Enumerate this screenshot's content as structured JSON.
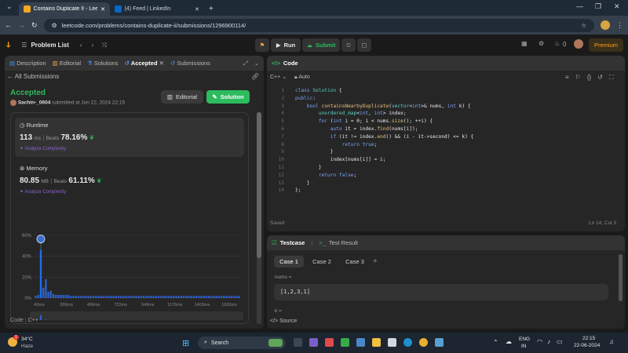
{
  "browser": {
    "tabs": [
      {
        "title": "Contains Duplicate II - LeetCode",
        "active": true
      },
      {
        "title": "(4) Feed | LinkedIn",
        "active": false
      }
    ],
    "url": "leetcode.com/problems/contains-duplicate-ii/submissions/1296900114/"
  },
  "nav": {
    "problem_list": "Problem List",
    "run": "Run",
    "submit": "Submit",
    "streak": "0",
    "premium": "Premium"
  },
  "left": {
    "tabs": [
      "Description",
      "Editorial",
      "Solutions",
      "Accepted",
      "Submissions"
    ],
    "all_submissions": "All Submissions",
    "status": "Accepted",
    "user": "Sachin-_0604",
    "submitted": "submitted at Jun 22, 2024 22:15",
    "editorial_btn": "Editorial",
    "solution_btn": "Solution",
    "runtime": {
      "label": "Runtime",
      "value": "113",
      "unit": "ms",
      "beats_label": "Beats",
      "beats": "78.16%",
      "analyze": "Analyze Complexity"
    },
    "memory": {
      "label": "Memory",
      "value": "80.85",
      "unit": "MB",
      "beats_label": "Beats",
      "beats": "61.11%",
      "analyze": "Analyze Complexity"
    },
    "footer": {
      "code": "Code",
      "lang": "C++"
    }
  },
  "chart_data": {
    "type": "bar",
    "y_ticks": [
      "60%",
      "40%",
      "20%",
      "0%"
    ],
    "ylim": [
      0,
      60
    ],
    "x_ticks": [
      "42ms",
      "269ms",
      "496ms",
      "722ms",
      "949ms",
      "1176ms",
      "1403ms",
      "1630ms"
    ],
    "values": [
      2,
      3,
      46,
      10,
      18,
      6,
      7,
      4,
      3,
      3,
      3,
      3,
      3,
      3,
      2,
      2,
      2,
      2,
      2,
      2,
      2,
      2,
      2,
      2,
      2,
      2,
      2,
      2,
      2,
      2,
      2,
      2,
      2,
      2,
      2,
      2,
      2,
      2,
      2,
      2,
      2,
      2,
      2,
      2,
      2,
      2,
      2,
      2,
      2,
      2,
      2,
      2,
      2,
      2,
      2,
      2,
      2,
      2,
      2,
      2,
      2,
      2,
      2,
      2,
      2,
      2,
      2,
      2,
      2,
      2,
      2,
      2,
      2,
      2,
      2,
      2,
      2,
      2,
      2,
      2,
      2,
      2
    ],
    "highlight_index": 2,
    "range_ticks": [
      "42ms",
      "496ms",
      "949ms",
      "1403ms"
    ]
  },
  "editor": {
    "title": "Code",
    "lang": "C++",
    "mode": "Auto",
    "saved": "Saved",
    "cursor": "Ln 14, Col 3",
    "lines": [
      "class Solution {",
      "public:",
      "    bool containsNearbyDuplicate(vector<int>& nums, int k) {",
      "        unordered_map<int, int> index;",
      "        for (int i = 0; i < nums.size(); ++i) {",
      "            auto it = index.find(nums[i]);",
      "            if (it != index.end() && (i - it->second) <= k) {",
      "                return true;",
      "            }",
      "            index[nums[i]] = i;",
      "        }",
      "        return false;",
      "    }",
      "};"
    ]
  },
  "testcase": {
    "tab": "Testcase",
    "result": "Test Result",
    "cases": [
      "Case 1",
      "Case 2",
      "Case 3"
    ],
    "param1": "nums =",
    "value1": "[1,2,3,1]",
    "param2": "k =",
    "source": "Source"
  },
  "taskbar": {
    "temp": "34°C",
    "cond": "Haze",
    "search": "Search",
    "lang1": "ENG",
    "lang2": "IN",
    "time": "22:15",
    "date": "22-06-2024",
    "badge": "1"
  }
}
